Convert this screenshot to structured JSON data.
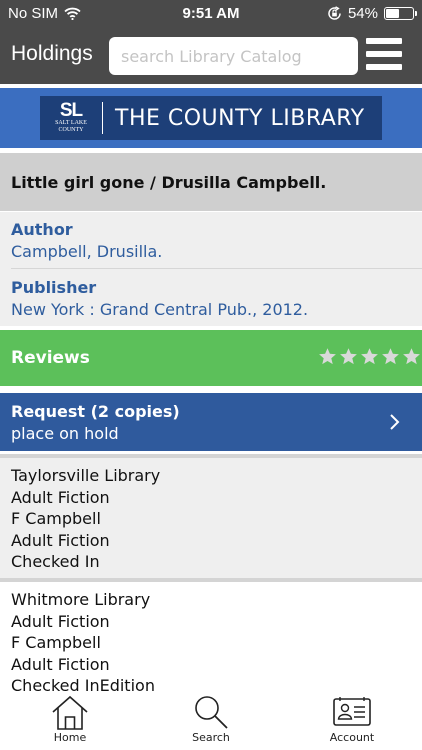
{
  "status_bar": {
    "carrier": "No SIM",
    "time": "9:51 AM",
    "battery_percent": "54%",
    "battery_level": 0.54,
    "icons": [
      "wifi-icon",
      "orientation-lock-icon",
      "battery-icon"
    ]
  },
  "header": {
    "title": "Holdings",
    "search_placeholder": "search Library Catalog",
    "search_value": "",
    "menu_icon": "hamburger-menu-icon"
  },
  "banner": {
    "logo_mark": "SL",
    "logo_subtext": "SALT LAKE COUNTY",
    "library_name": "THE COUNTY LIBRARY",
    "colors": {
      "background": "#3b6ec0",
      "logo_background": "#1d3f78"
    }
  },
  "book": {
    "title": "Little girl gone / Drusilla Campbell.",
    "author_label": "Author",
    "author": "Campbell, Drusilla.",
    "publisher_label": "Publisher",
    "publisher": "New York : Grand Central Pub., 2012."
  },
  "reviews": {
    "label": "Reviews",
    "rating": 0,
    "max_stars": 5,
    "colors": {
      "background": "#5cc05a",
      "star": "#d9d9d9"
    }
  },
  "request": {
    "title": "Request (2 copies)",
    "subtitle": "place on hold",
    "icon": "chevron-right-icon",
    "color": "#2f5a9d"
  },
  "holdings": [
    {
      "library": "Taylorsville Library",
      "collection": "Adult Fiction",
      "call_number": "F Campbell",
      "location": "Adult Fiction",
      "status": "Checked In"
    },
    {
      "library": "Whitmore Library",
      "collection": "Adult Fiction",
      "call_number": "F Campbell",
      "location": "Adult Fiction",
      "status": "Checked InEdition"
    }
  ],
  "tabbar": {
    "items": [
      {
        "label": "Home",
        "icon": "home-icon"
      },
      {
        "label": "Search",
        "icon": "search-icon"
      },
      {
        "label": "Account",
        "icon": "account-card-icon"
      }
    ]
  }
}
